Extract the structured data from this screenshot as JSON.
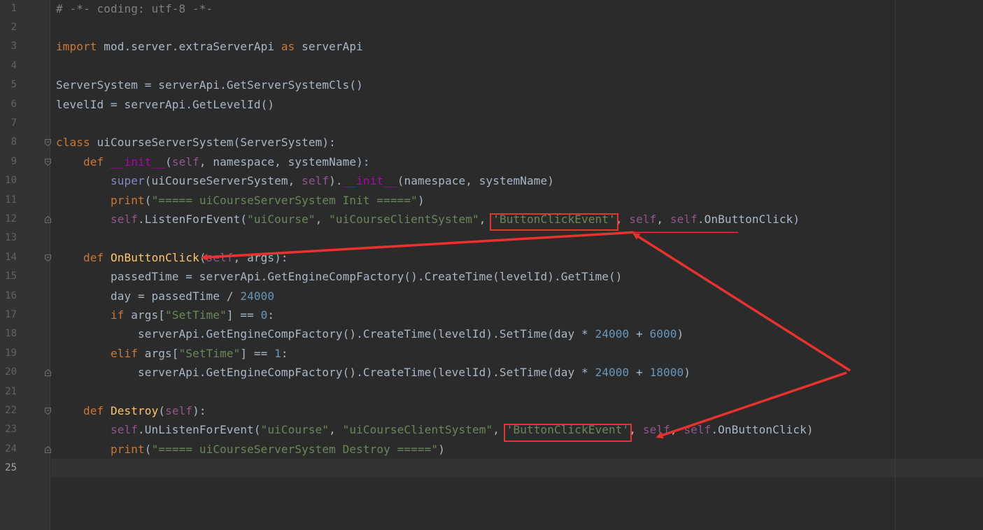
{
  "editor": {
    "current_line": 25,
    "line_numbers": [
      "1",
      "2",
      "3",
      "4",
      "5",
      "6",
      "7",
      "8",
      "9",
      "10",
      "11",
      "12",
      "13",
      "14",
      "15",
      "16",
      "17",
      "18",
      "19",
      "20",
      "21",
      "22",
      "23",
      "24",
      "25"
    ],
    "lines": [
      [
        {
          "t": "# -*- coding: utf-8 -*-",
          "c": "c"
        }
      ],
      [],
      [
        {
          "t": "import",
          "c": "k"
        },
        {
          "t": " mod.server.extraServerApi "
        },
        {
          "t": "as",
          "c": "k"
        },
        {
          "t": " serverApi"
        }
      ],
      [],
      [
        {
          "t": "ServerSystem = serverApi.GetServerSystemCls()"
        }
      ],
      [
        {
          "t": "levelId = serverApi.GetLevelId()"
        }
      ],
      [],
      [
        {
          "t": "class",
          "c": "k"
        },
        {
          "t": " uiCourseServerSystem(ServerSystem):"
        }
      ],
      [
        {
          "t": "    "
        },
        {
          "t": "def",
          "c": "k"
        },
        {
          "t": " "
        },
        {
          "t": "__init__",
          "c": "dm"
        },
        {
          "t": "("
        },
        {
          "t": "self",
          "c": "sf"
        },
        {
          "t": ", namespace, systemName):"
        }
      ],
      [
        {
          "t": "        "
        },
        {
          "t": "super",
          "c": "bi"
        },
        {
          "t": "(uiCourseServerSystem, "
        },
        {
          "t": "self",
          "c": "sf"
        },
        {
          "t": ")."
        },
        {
          "t": "__init__",
          "c": "dm"
        },
        {
          "t": "(namespace, systemName)"
        }
      ],
      [
        {
          "t": "        "
        },
        {
          "t": "print",
          "c": "k"
        },
        {
          "t": "("
        },
        {
          "t": "\"===== uiCourseServerSystem Init =====\"",
          "c": "s"
        },
        {
          "t": ")"
        }
      ],
      [
        {
          "t": "        "
        },
        {
          "t": "self",
          "c": "sf"
        },
        {
          "t": ".ListenForEvent("
        },
        {
          "t": "\"uiCourse\"",
          "c": "s"
        },
        {
          "t": ", "
        },
        {
          "t": "\"uiCourseClientSystem\"",
          "c": "s"
        },
        {
          "t": ", "
        },
        {
          "t": "'ButtonClickEvent'",
          "c": "s"
        },
        {
          "t": ", "
        },
        {
          "t": "self",
          "c": "sf"
        },
        {
          "t": ", "
        },
        {
          "t": "self",
          "c": "sf"
        },
        {
          "t": ".OnButtonClick)"
        }
      ],
      [],
      [
        {
          "t": "    "
        },
        {
          "t": "def",
          "c": "k"
        },
        {
          "t": " "
        },
        {
          "t": "OnButtonClick",
          "c": "fn"
        },
        {
          "t": "("
        },
        {
          "t": "self",
          "c": "sf"
        },
        {
          "t": ", args):"
        }
      ],
      [
        {
          "t": "        passedTime = serverApi.GetEngineCompFactory().CreateTime(levelId).GetTime()"
        }
      ],
      [
        {
          "t": "        day = passedTime / "
        },
        {
          "t": "24000",
          "c": "n"
        }
      ],
      [
        {
          "t": "        "
        },
        {
          "t": "if",
          "c": "k"
        },
        {
          "t": " args["
        },
        {
          "t": "\"SetTime\"",
          "c": "s"
        },
        {
          "t": "] == "
        },
        {
          "t": "0",
          "c": "n"
        },
        {
          "t": ":"
        }
      ],
      [
        {
          "t": "            serverApi.GetEngineCompFactory().CreateTime(levelId).SetTime(day * "
        },
        {
          "t": "24000",
          "c": "n"
        },
        {
          "t": " + "
        },
        {
          "t": "6000",
          "c": "n"
        },
        {
          "t": ")"
        }
      ],
      [
        {
          "t": "        "
        },
        {
          "t": "elif",
          "c": "k"
        },
        {
          "t": " args["
        },
        {
          "t": "\"SetTime\"",
          "c": "s"
        },
        {
          "t": "] == "
        },
        {
          "t": "1",
          "c": "n"
        },
        {
          "t": ":"
        }
      ],
      [
        {
          "t": "            serverApi.GetEngineCompFactory().CreateTime(levelId).SetTime(day * "
        },
        {
          "t": "24000",
          "c": "n"
        },
        {
          "t": " + "
        },
        {
          "t": "18000",
          "c": "n"
        },
        {
          "t": ")"
        }
      ],
      [],
      [
        {
          "t": "    "
        },
        {
          "t": "def",
          "c": "k"
        },
        {
          "t": " "
        },
        {
          "t": "Destroy",
          "c": "fn"
        },
        {
          "t": "("
        },
        {
          "t": "self",
          "c": "sf"
        },
        {
          "t": "):"
        }
      ],
      [
        {
          "t": "        "
        },
        {
          "t": "self",
          "c": "sf"
        },
        {
          "t": ".UnListenForEvent("
        },
        {
          "t": "\"uiCourse\"",
          "c": "s"
        },
        {
          "t": ", "
        },
        {
          "t": "\"uiCourseClientSystem\"",
          "c": "s"
        },
        {
          "t": ", "
        },
        {
          "t": "'ButtonClickEvent'",
          "c": "s"
        },
        {
          "t": ", "
        },
        {
          "t": "self",
          "c": "sf"
        },
        {
          "t": ", "
        },
        {
          "t": "self",
          "c": "sf"
        },
        {
          "t": ".OnButtonClick)"
        }
      ],
      [
        {
          "t": "        "
        },
        {
          "t": "print",
          "c": "k"
        },
        {
          "t": "("
        },
        {
          "t": "\"===== uiCourseServerSystem Destroy =====\"",
          "c": "s"
        },
        {
          "t": ")"
        }
      ],
      []
    ],
    "fold_markers": [
      {
        "line": 8,
        "kind": "open"
      },
      {
        "line": 9,
        "kind": "open"
      },
      {
        "line": 12,
        "kind": "close"
      },
      {
        "line": 14,
        "kind": "open"
      },
      {
        "line": 20,
        "kind": "close"
      },
      {
        "line": 22,
        "kind": "open"
      },
      {
        "line": 24,
        "kind": "close"
      }
    ]
  },
  "annotation": {
    "color": "#e8322e",
    "highlighted_text": "'ButtonClickEvent'",
    "highlight_lines": [
      12,
      23
    ],
    "arrow_target_text": "OnButtonClick",
    "arrow_target_line": 14
  }
}
